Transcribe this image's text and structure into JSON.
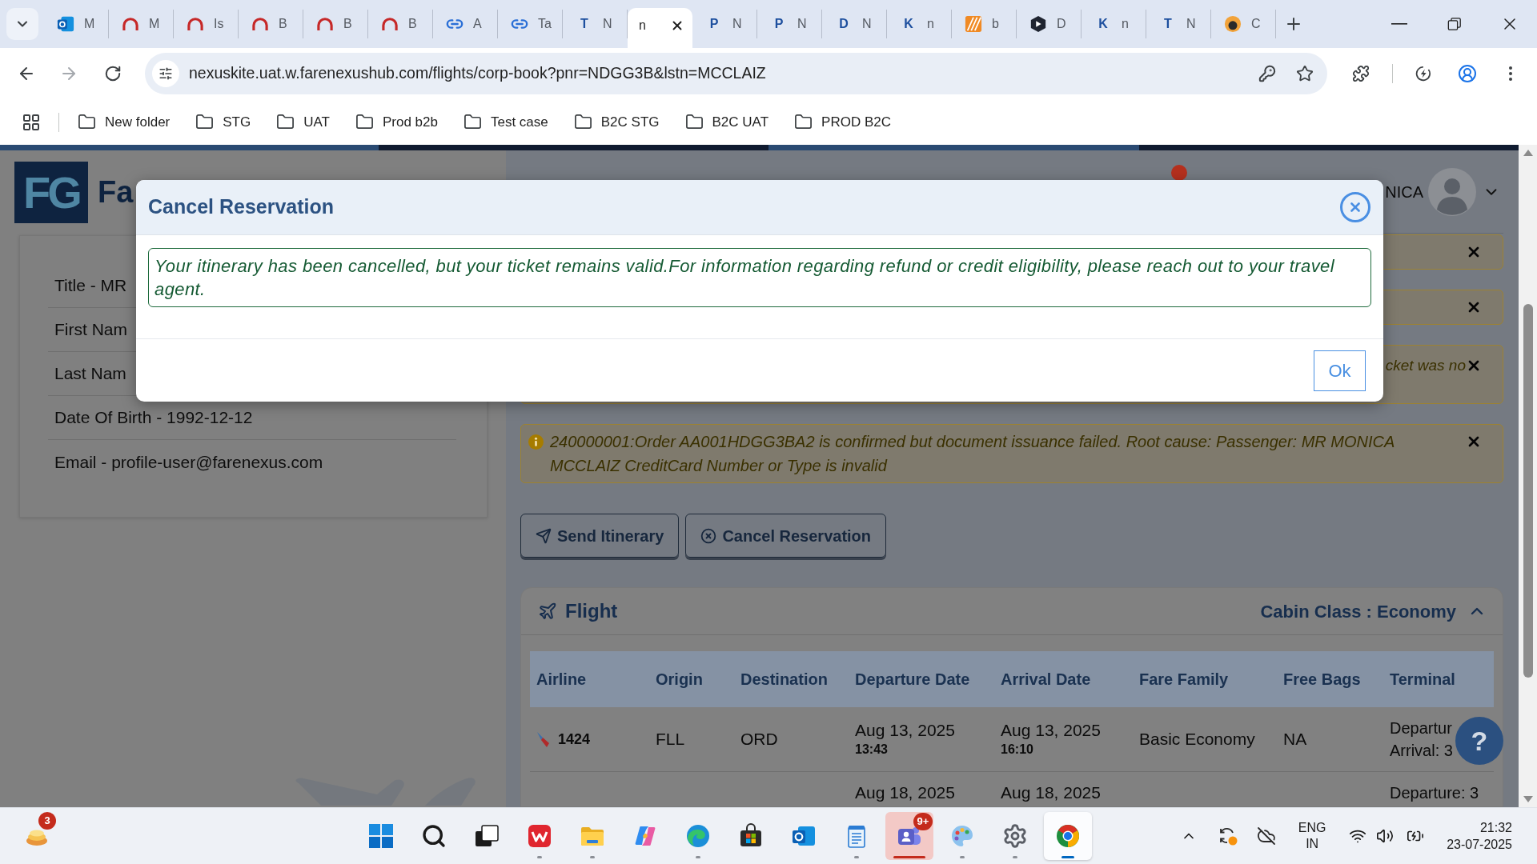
{
  "browser": {
    "tabs": [
      {
        "kind": "mail",
        "title": "M",
        "selected": false
      },
      {
        "kind": "arch",
        "title": "M",
        "selected": false
      },
      {
        "kind": "arch",
        "title": "Is",
        "selected": false
      },
      {
        "kind": "arch",
        "title": "B",
        "selected": false
      },
      {
        "kind": "arch",
        "title": "B",
        "selected": false
      },
      {
        "kind": "arch",
        "title": "B",
        "selected": false
      },
      {
        "kind": "link",
        "title": "A",
        "selected": false
      },
      {
        "kind": "link",
        "title": "Ta",
        "selected": false
      },
      {
        "kind": "letter",
        "letter": "T",
        "title": "N",
        "selected": false
      },
      {
        "kind": "none",
        "title": "n",
        "selected": true
      },
      {
        "kind": "letter",
        "letter": "P",
        "title": "N",
        "selected": false
      },
      {
        "kind": "letter",
        "letter": "P",
        "title": "N",
        "selected": false
      },
      {
        "kind": "letter",
        "letter": "D",
        "title": "N",
        "selected": false
      },
      {
        "kind": "letter",
        "letter": "K",
        "title": "n",
        "selected": false
      },
      {
        "kind": "stripes",
        "title": "b",
        "selected": false
      },
      {
        "kind": "hexagon",
        "title": "D",
        "selected": false
      },
      {
        "kind": "letter",
        "letter": "K",
        "title": "n",
        "selected": false
      },
      {
        "kind": "letter",
        "letter": "T",
        "title": "N",
        "selected": false
      },
      {
        "kind": "round",
        "title": "C",
        "selected": false
      }
    ],
    "forward_disabled": true,
    "url": "nexuskite.uat.w.farenexushub.com/flights/corp-book?pnr=NDGG3B&lstn=MCCLAIZ",
    "bookmarks": [
      "New folder",
      "STG",
      "UAT",
      "Prod b2b",
      "Test case",
      "B2C STG",
      "B2C UAT",
      "PROD B2C"
    ]
  },
  "page": {
    "logo": {
      "mark": "FG",
      "name": "Fa"
    },
    "profile": [
      "Title - MR",
      "First Nam",
      "Last Nam",
      "Date Of Birth - 1992-12-12",
      "Email - profile-user@farenexus.com"
    ],
    "user": {
      "name": "NICA"
    },
    "alerts": [
      {
        "kind": "short"
      },
      {
        "kind": "short"
      },
      {
        "kind": "tall",
        "text": "cket was no"
      },
      {
        "kind": "info",
        "text": "240000001:Order AA001HDGG3BA2 is confirmed but document issuance failed. Root cause: Passenger: MR MONICA MCCLAIZ CreditCard Number or Type is invalid"
      }
    ],
    "actions": [
      {
        "kind": "send",
        "label": "Send Itinerary"
      },
      {
        "kind": "cancel",
        "label": "Cancel Reservation"
      }
    ],
    "flight": {
      "title": "Flight",
      "cabin_class": "Cabin Class : Economy",
      "expanded": true,
      "table": {
        "columns": [
          "Airline",
          "Origin",
          "Destination",
          "Departure Date",
          "Arrival Date",
          "Fare Family",
          "Free Bags",
          "Terminal"
        ],
        "rows": [
          {
            "flight": "1424",
            "origin": "FLL",
            "destination": "ORD",
            "departure": {
              "date": "Aug 13, 2025",
              "time": "13:43"
            },
            "arrival": {
              "date": "Aug 13, 2025",
              "time": "16:10"
            },
            "fare_family": "Basic Economy",
            "free_bags": "NA",
            "terminal": [
              "Departur",
              "Arrival: 3"
            ]
          },
          {
            "departure": {
              "date": "Aug 18, 2025"
            },
            "arrival": {
              "date": "Aug 18, 2025"
            },
            "terminal": [
              "Departure: 3"
            ]
          }
        ]
      }
    },
    "help_button": "?"
  },
  "dialog": {
    "title": "Cancel Reservation",
    "message": "Your itinerary has been cancelled, but your ticket remains valid.For information regarding refund or credit eligibility, please reach out to your travel agent.",
    "button": "Ok"
  },
  "taskbar": {
    "widgets_badge": "3",
    "apps": [
      {
        "kind": "tiles",
        "running": false,
        "selected": false,
        "attention": false
      },
      {
        "kind": "search",
        "running": false,
        "selected": false,
        "attention": false
      },
      {
        "kind": "task_view",
        "running": false,
        "selected": false,
        "attention": false
      },
      {
        "kind": "zigzag_tile",
        "running": true,
        "selected": false,
        "attention": false
      },
      {
        "kind": "folder",
        "running": true,
        "selected": false,
        "attention": false
      },
      {
        "kind": "swirl",
        "running": false,
        "selected": false,
        "attention": false
      },
      {
        "kind": "wave",
        "running": true,
        "selected": false,
        "attention": false
      },
      {
        "kind": "store",
        "running": false,
        "selected": false,
        "attention": false
      },
      {
        "kind": "mail",
        "running": false,
        "selected": false,
        "attention": false
      },
      {
        "kind": "notepad",
        "running": true,
        "selected": false,
        "attention": false
      },
      {
        "kind": "people",
        "running": true,
        "selected": false,
        "attention": true,
        "badge": "9+"
      },
      {
        "kind": "palette",
        "running": true,
        "selected": false,
        "attention": false
      },
      {
        "kind": "gear",
        "running": true,
        "selected": false,
        "attention": false
      },
      {
        "kind": "circle_logo",
        "running": true,
        "selected": true,
        "attention": false
      }
    ],
    "tray": {
      "language": "ENG",
      "region": "IN",
      "time": "21:32",
      "date": "23-07-2025"
    }
  }
}
